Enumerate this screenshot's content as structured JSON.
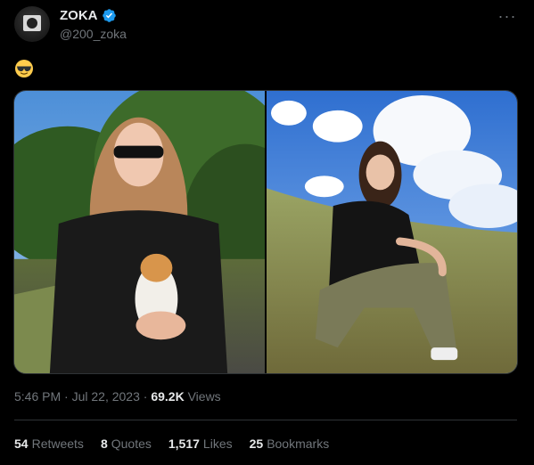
{
  "user": {
    "display_name": "ZOKA",
    "handle": "@200_zoka",
    "verified_icon": "verified-badge-icon"
  },
  "tweet": {
    "text": "😎",
    "time": "5:46 PM",
    "date": "Jul 22, 2023",
    "views_count": "69.2K",
    "views_label": "Views"
  },
  "stats": {
    "retweets": {
      "count": "54",
      "label": "Retweets"
    },
    "quotes": {
      "count": "8",
      "label": "Quotes"
    },
    "likes": {
      "count": "1,517",
      "label": "Likes"
    },
    "bookmarks": {
      "count": "25",
      "label": "Bookmarks"
    }
  },
  "colors": {
    "background": "#000000",
    "text_primary": "#e7e9ea",
    "text_secondary": "#71767b",
    "verified": "#1d9bf0",
    "border": "#2f3336"
  }
}
